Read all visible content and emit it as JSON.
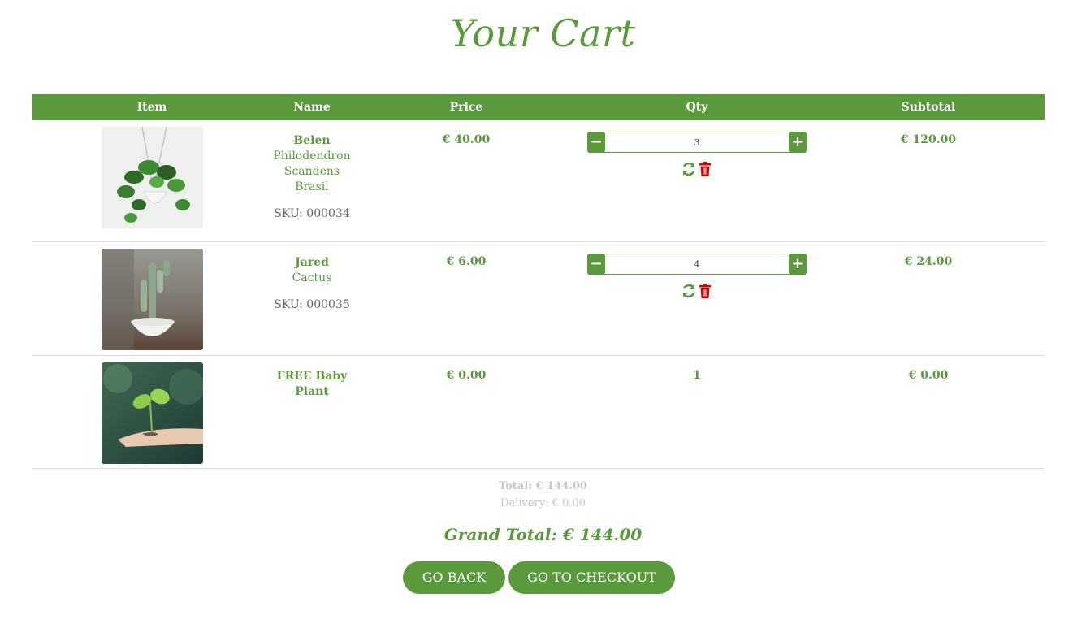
{
  "page": {
    "title": "Your Cart"
  },
  "table": {
    "headers": {
      "item": "Item",
      "name": "Name",
      "price": "Price",
      "qty": "Qty",
      "subtotal": "Subtotal"
    }
  },
  "items": [
    {
      "name": "Belen",
      "variant": "Philodendron Scandens Brasil",
      "sku": "SKU: 000034",
      "price": "€ 40.00",
      "qty": "3",
      "subtotal": "€ 120.00",
      "image_icon": "hanging-plant-photo"
    },
    {
      "name": "Jared",
      "variant": "Cactus",
      "sku": "SKU: 000035",
      "price": "€ 6.00",
      "qty": "4",
      "subtotal": "€ 24.00",
      "image_icon": "cactus-photo"
    },
    {
      "name": "FREE Baby Plant",
      "price": "€ 0.00",
      "qty": "1",
      "subtotal": "€ 0.00",
      "image_icon": "seedling-photo"
    }
  ],
  "summary": {
    "total": "Total: € 144.00",
    "delivery": "Delivery: € 0.00",
    "grand_total": "Grand Total: € 144.00"
  },
  "buttons": {
    "back": "GO BACK",
    "checkout": "GO TO CHECKOUT"
  },
  "icons": {
    "minus": "−",
    "plus": "+",
    "update": "refresh-icon",
    "remove": "trash-icon"
  },
  "colors": {
    "accent": "#5a9a3c",
    "remove": "#e00000",
    "muted": "#c8c8c8"
  }
}
